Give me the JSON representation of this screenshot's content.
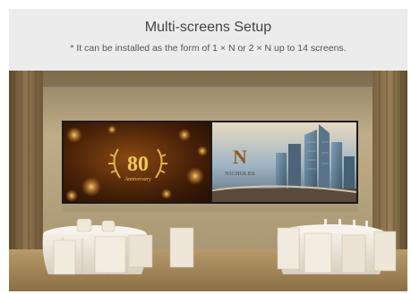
{
  "header": {
    "title": "Multi-screens Setup",
    "caption": "* It can be installed as the form of 1 × N or 2 × N up to 14 screens."
  },
  "screen_content": {
    "left_number": "80",
    "left_word": "Anniversary",
    "right_logo_letter": "N",
    "right_brand": "NICHOLES"
  },
  "colors": {
    "header_bg": "#ececec",
    "wall": "#b8a581",
    "floor": "#a78a5e",
    "gold": "#d9a441"
  }
}
